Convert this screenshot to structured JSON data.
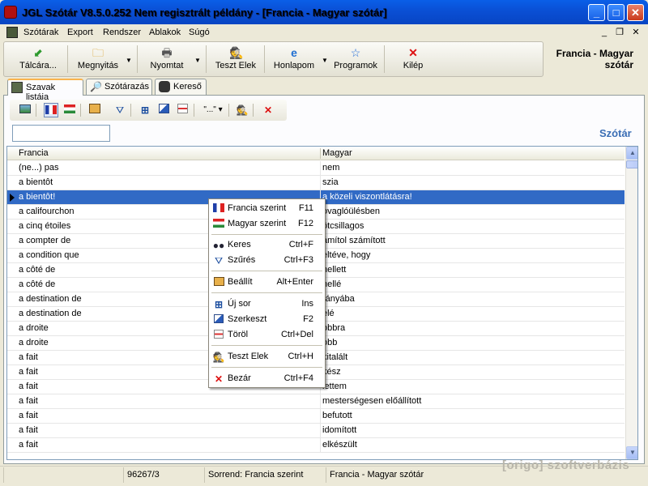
{
  "window": {
    "title": "JGL Szótár V8.5.0.252 Nem regisztrált példány - [Francia - Magyar szótár]"
  },
  "menu": [
    "Szótárak",
    "Export",
    "Rendszer",
    "Ablakok",
    "Súgó"
  ],
  "toolbar": {
    "buttons": [
      "Tálcára...",
      "Megnyitás",
      "Nyomtat",
      "Teszt Elek",
      "Honlapom",
      "Programok",
      "Kilép"
    ],
    "dict_title": "Francia - Magyar szótár"
  },
  "tabs": [
    "Szavak listája",
    "Szótárazás",
    "Kereső"
  ],
  "search": {
    "value": "",
    "dict_label": "Szótár"
  },
  "grid": {
    "columns": [
      "Francia",
      "Magyar"
    ],
    "rows": [
      [
        "(ne...) pas",
        "nem"
      ],
      [
        "a bientôt",
        "szia"
      ],
      [
        "a bientôt!",
        "a közeli viszontlátásra!"
      ],
      [
        "a califourchon",
        "lovaglóülésben"
      ],
      [
        "a cinq étoiles",
        "ötcsillagos"
      ],
      [
        "a compter de",
        "-tól/-től számított"
      ],
      [
        "a condition que",
        "feltéve, hogy"
      ],
      [
        "a côté de",
        "mellett"
      ],
      [
        "a côté de",
        "mellé"
      ],
      [
        "a destination de",
        "irányába"
      ],
      [
        "a destination de",
        "felé"
      ],
      [
        "a droite",
        "jobbra"
      ],
      [
        "a droite",
        "jobb"
      ],
      [
        "a fait",
        "kitalált"
      ],
      [
        "a fait",
        "kész"
      ],
      [
        "a fait",
        "lettem"
      ],
      [
        "a fait",
        "mesterségesen előállított"
      ],
      [
        "a fait",
        "befutott"
      ],
      [
        "a fait",
        "idomított"
      ],
      [
        "a fait",
        "elkészült"
      ]
    ],
    "visible_right": [
      "nem",
      "szia",
      "a közeli viszontlátásra!",
      "ovaglóülésben",
      "ötcsillagos",
      "ámítol számított",
      "eltéve, hogy",
      "nellett",
      "nellé",
      "rányába",
      "elé",
      "obbra",
      "obb",
      "kitalált",
      "kész",
      "lettem",
      "mesterségesen előállított",
      "befutott",
      "idomított",
      "elkészült"
    ]
  },
  "context_menu": {
    "items": [
      {
        "label": "Francia szerint",
        "key": "F11",
        "icon": "french-flag-icon"
      },
      {
        "label": "Magyar szerint",
        "key": "F12",
        "icon": "hungarian-flag-icon"
      },
      {
        "label": "Keres",
        "key": "Ctrl+F",
        "icon": "binoculars-icon"
      },
      {
        "label": "Szűrés",
        "key": "Ctrl+F3",
        "icon": "filter-icon"
      },
      {
        "label": "Beállít",
        "key": "Alt+Enter",
        "icon": "settings-icon"
      },
      {
        "label": "Új sor",
        "key": "Ins",
        "icon": "new-row-icon"
      },
      {
        "label": "Szerkeszt",
        "key": "F2",
        "icon": "edit-icon"
      },
      {
        "label": "Töröl",
        "key": "Ctrl+Del",
        "icon": "delete-row-icon"
      },
      {
        "label": "Teszt Elek",
        "key": "Ctrl+H",
        "icon": "detective-icon"
      },
      {
        "label": "Bezár",
        "key": "Ctrl+F4",
        "icon": "close-icon"
      }
    ]
  },
  "status": {
    "count": "96267/3",
    "sort": "Sorrend: Francia szerint",
    "dict": "Francia - Magyar szótár",
    "watermark": "[origo] szoftverbázis"
  }
}
